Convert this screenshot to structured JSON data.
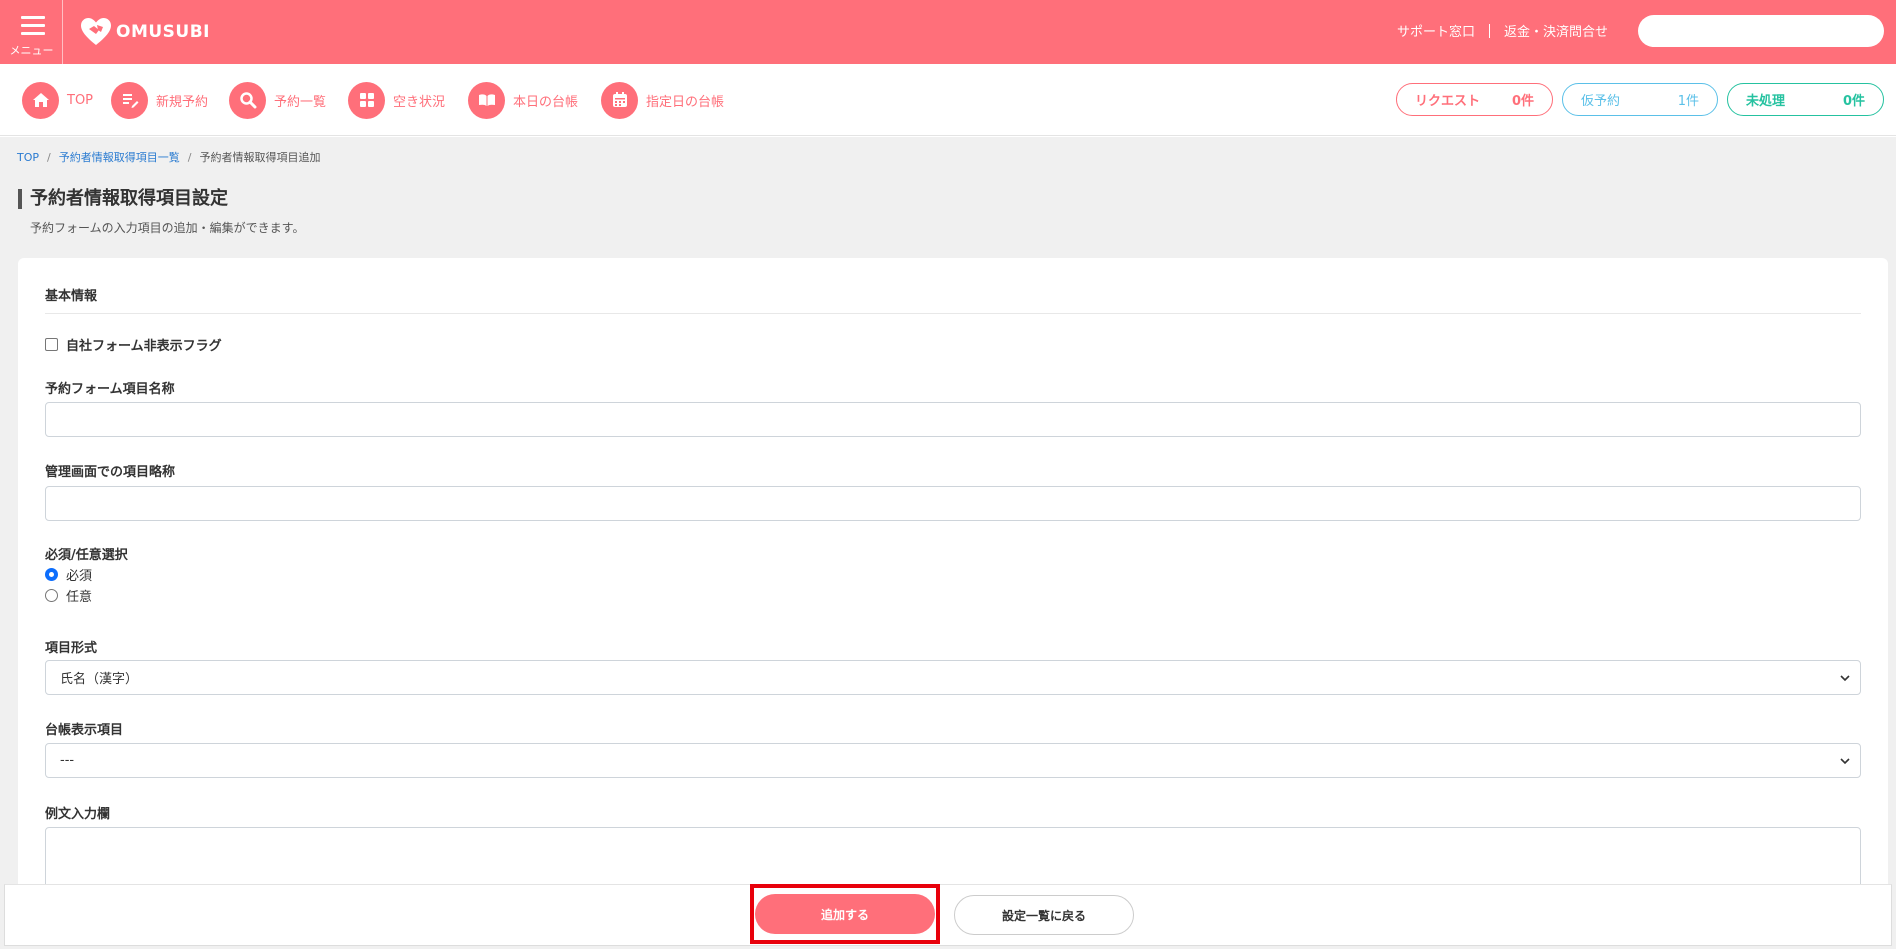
{
  "header": {
    "menu_label": "メニュー",
    "brand": "OMUSUBI",
    "links": [
      "サポート窓口",
      "返金・決済問合せ"
    ],
    "search_value": "",
    "accent_color": "#ff6f7a"
  },
  "nav": {
    "items": [
      {
        "label": "TOP",
        "icon": "home-icon"
      },
      {
        "label": "新規予約",
        "icon": "edit-icon"
      },
      {
        "label": "予約一覧",
        "icon": "search-icon"
      },
      {
        "label": "空き状況",
        "icon": "grid-icon"
      },
      {
        "label": "本日の台帳",
        "icon": "book-icon"
      },
      {
        "label": "指定日の台帳",
        "icon": "calendar-icon"
      }
    ],
    "status": {
      "request": {
        "label": "リクエスト",
        "count": "0件",
        "color": "#ff6f7a"
      },
      "temp": {
        "label": "仮予約",
        "count": "1件",
        "color": "#5bc0e8"
      },
      "unprocessed": {
        "label": "未処理",
        "count": "0件",
        "color": "#25c2a0"
      }
    }
  },
  "breadcrumb": [
    "TOP",
    "予約者情報取得項目一覧",
    "予約者情報取得項目追加"
  ],
  "page": {
    "title": "予約者情報取得項目設定",
    "description": "予約フォームの入力項目の追加・編集ができます。"
  },
  "form": {
    "section_title": "基本情報",
    "hide_flag_label": "自社フォーム非表示フラグ",
    "hide_flag_checked": false,
    "item_name_label": "予約フォーム項目名称",
    "item_name_value": "",
    "admin_abbr_label": "管理画面での項目略称",
    "admin_abbr_value": "",
    "required_label": "必須/任意選択",
    "required_options": [
      "必須",
      "任意"
    ],
    "required_selected": "必須",
    "format_label": "項目形式",
    "format_selected": "氏名（漢字）",
    "ledger_label": "台帳表示項目",
    "ledger_selected": "---",
    "example_label": "例文入力欄",
    "example_value": ""
  },
  "footer": {
    "add_button": "追加する",
    "back_button": "設定一覧に戻る"
  }
}
